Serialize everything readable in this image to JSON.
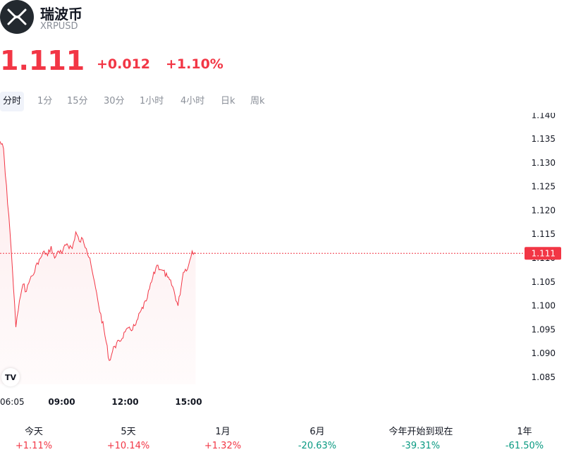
{
  "header": {
    "name": "瑞波币",
    "symbol": "XRPUSD",
    "logo_icon": "xrp-logo-icon"
  },
  "quote": {
    "price": "1.111",
    "change": "+0.012",
    "change_pct": "+1.10%",
    "color": "#f23645"
  },
  "tabs": [
    {
      "label": "分时",
      "active": true
    },
    {
      "label": "1分"
    },
    {
      "label": "15分"
    },
    {
      "label": "30分"
    },
    {
      "label": "1小时"
    },
    {
      "label": "4小时"
    },
    {
      "label": "日k"
    },
    {
      "label": "周k"
    }
  ],
  "chart_data": {
    "type": "area",
    "line_color": "#f23645",
    "y_ticks": [
      "1.140",
      "1.135",
      "1.130",
      "1.125",
      "1.120",
      "1.115",
      "1.110",
      "1.105",
      "1.100",
      "1.095",
      "1.090",
      "1.085"
    ],
    "ylim": [
      1.0835,
      1.1405
    ],
    "x_ticks": [
      "06:05",
      "09:00",
      "12:00",
      "15:00"
    ],
    "current_price_label": "1.111",
    "current_price": 1.111,
    "x": [
      "06:05",
      "06:15",
      "06:20",
      "06:30",
      "06:40",
      "06:50",
      "07:00",
      "07:10",
      "07:20",
      "07:30",
      "07:40",
      "07:50",
      "08:00",
      "08:10",
      "08:20",
      "08:30",
      "08:40",
      "08:50",
      "09:00",
      "09:15",
      "09:30",
      "09:40",
      "09:50",
      "10:00",
      "10:10",
      "10:20",
      "10:30",
      "10:45",
      "11:00",
      "11:15",
      "11:30",
      "11:45",
      "12:00",
      "12:15",
      "12:30",
      "12:45",
      "13:00",
      "13:15",
      "13:30",
      "13:45",
      "14:00",
      "14:15",
      "14:30",
      "14:45",
      "15:00",
      "15:10",
      "15:20"
    ],
    "values": [
      1.1345,
      1.133,
      1.1275,
      1.119,
      1.108,
      1.0955,
      1.101,
      1.1045,
      1.103,
      1.1055,
      1.1065,
      1.109,
      1.11,
      1.1115,
      1.1105,
      1.1125,
      1.11,
      1.1115,
      1.111,
      1.113,
      1.112,
      1.1155,
      1.1135,
      1.114,
      1.112,
      1.11,
      1.106,
      1.1,
      1.095,
      1.0885,
      1.0915,
      1.0925,
      1.0945,
      1.095,
      1.096,
      1.099,
      1.101,
      1.105,
      1.1085,
      1.1075,
      1.106,
      1.104,
      1.1,
      1.107,
      1.1085,
      1.1115,
      1.111
    ]
  },
  "periods": [
    {
      "label": "今天",
      "value": "+1.11%",
      "dir": "up"
    },
    {
      "label": "5天",
      "value": "+10.14%",
      "dir": "up"
    },
    {
      "label": "1月",
      "value": "+1.32%",
      "dir": "up"
    },
    {
      "label": "6月",
      "value": "-20.63%",
      "dir": "down"
    },
    {
      "label": "今年开始到现在",
      "value": "-39.31%",
      "dir": "down"
    },
    {
      "label": "1年",
      "value": "-61.50%",
      "dir": "down"
    }
  ]
}
